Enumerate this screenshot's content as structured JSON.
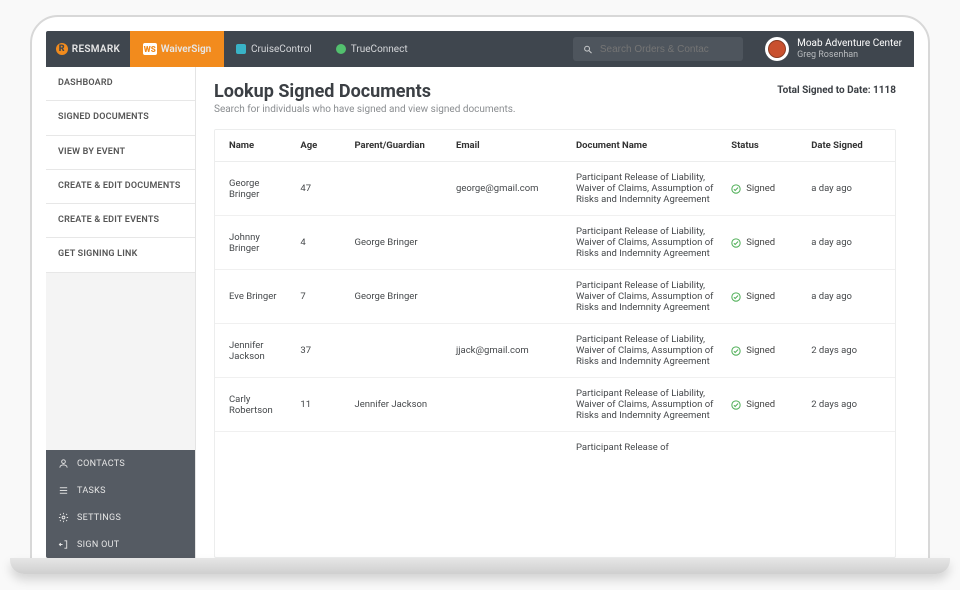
{
  "topnav": {
    "resmark": "RESMARK",
    "waiversign": "WaiverSign",
    "cruise": "CruiseControl",
    "trueconnect": "TrueConnect",
    "search_placeholder": "Search Orders & Contac",
    "org": "Moab Adventure Center",
    "user": "Greg Rosenhan"
  },
  "sidebar": {
    "items": [
      "DASHBOARD",
      "SIGNED DOCUMENTS",
      "VIEW BY EVENT",
      "CREATE & EDIT DOCUMENTS",
      "CREATE & EDIT EVENTS",
      "GET SIGNING LINK"
    ],
    "dark": [
      "CONTACTS",
      "TASKS",
      "SETTINGS",
      "SIGN OUT"
    ]
  },
  "page": {
    "title": "Lookup Signed Documents",
    "subtitle": "Search for individuals who have signed and view signed documents.",
    "total_label": "Total Signed to Date: 1118"
  },
  "table": {
    "headers": [
      "Name",
      "Age",
      "Parent/Guardian",
      "Email",
      "Document Name",
      "Status",
      "Date Signed"
    ],
    "doc_name": "Participant Release of Liability, Waiver of Claims, Assumption of Risks and Indemnity Agreement",
    "doc_name_trunc": "Participant Release of",
    "status_label": "Signed",
    "rows": [
      {
        "name": "George Bringer",
        "age": "47",
        "parent": "",
        "email": "george@gmail.com",
        "date": "a day ago"
      },
      {
        "name": "Johnny Bringer",
        "age": "4",
        "parent": "George Bringer",
        "email": "",
        "date": "a day ago"
      },
      {
        "name": "Eve Bringer",
        "age": "7",
        "parent": "George Bringer",
        "email": "",
        "date": "a day ago"
      },
      {
        "name": "Jennifer Jackson",
        "age": "37",
        "parent": "",
        "email": "jjack@gmail.com",
        "date": "2 days ago"
      },
      {
        "name": "Carly Robertson",
        "age": "11",
        "parent": "Jennifer Jackson",
        "email": "",
        "date": "2 days ago"
      }
    ]
  }
}
